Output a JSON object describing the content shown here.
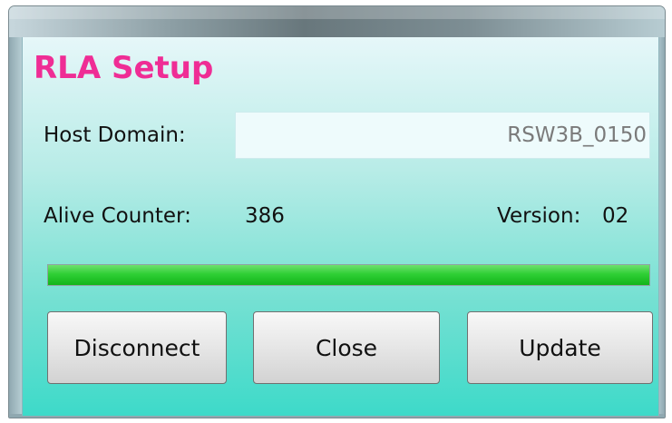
{
  "window": {
    "heading": "RLA Setup"
  },
  "form": {
    "host_domain_label": "Host Domain:",
    "host_domain_value": "RSW3B_0150",
    "alive_counter_label": "Alive Counter:",
    "alive_counter_value": "386",
    "version_label": "Version:",
    "version_value": "02"
  },
  "progress": {
    "value_percent": 100,
    "color": "#2fcf35"
  },
  "buttons": {
    "disconnect": "Disconnect",
    "close": "Close",
    "update": "Update"
  },
  "colors": {
    "heading": "#ef2d95",
    "background_top": "#e6f7f9",
    "background_bottom": "#3ddac9",
    "button_border": "#707070"
  }
}
